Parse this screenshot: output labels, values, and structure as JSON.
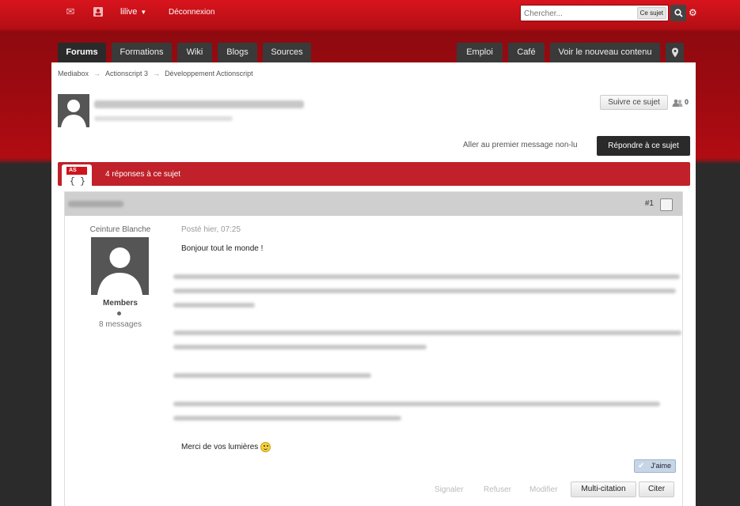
{
  "topbar": {
    "icons": [
      "mail-icon",
      "contact-icon"
    ],
    "username": "lilive",
    "logout": "Déconnexion",
    "search": {
      "placeholder": "Chercher...",
      "scope": "Ce sujet"
    }
  },
  "nav": {
    "left": [
      "Forums",
      "Formations",
      "Wiki",
      "Blogs",
      "Sources"
    ],
    "right": [
      "Emploi",
      "Café",
      "Voir le nouveau contenu"
    ],
    "active": "Forums"
  },
  "breadcrumb": [
    "Mediabox",
    "Actionscript 3",
    "Développement Actionscript"
  ],
  "topic": {
    "follow_label": "Suivre ce sujet",
    "followers_count": "0",
    "first_unread": "Aller au premier message non-lu",
    "reply_label": "Répondre à ce sujet",
    "replies_label": "4 réponses à ce sujet",
    "forum_icon_tag": "AS"
  },
  "post": {
    "number": "#1",
    "rank": "Ceinture Blanche",
    "group": "Members",
    "message_count": "8 messages",
    "date": "Posté hier, 07:25",
    "greeting": "Bonjour tout le monde !",
    "closing": "Merci de vos lumières",
    "like_label": "J'aime",
    "actions": {
      "report": "Signaler",
      "refuse": "Refuser",
      "edit": "Modifier",
      "multiquote": "Multi-citation",
      "quote": "Citer"
    }
  },
  "colors": {
    "brand_red": "#c0212a",
    "dark": "#2a2a2a"
  }
}
